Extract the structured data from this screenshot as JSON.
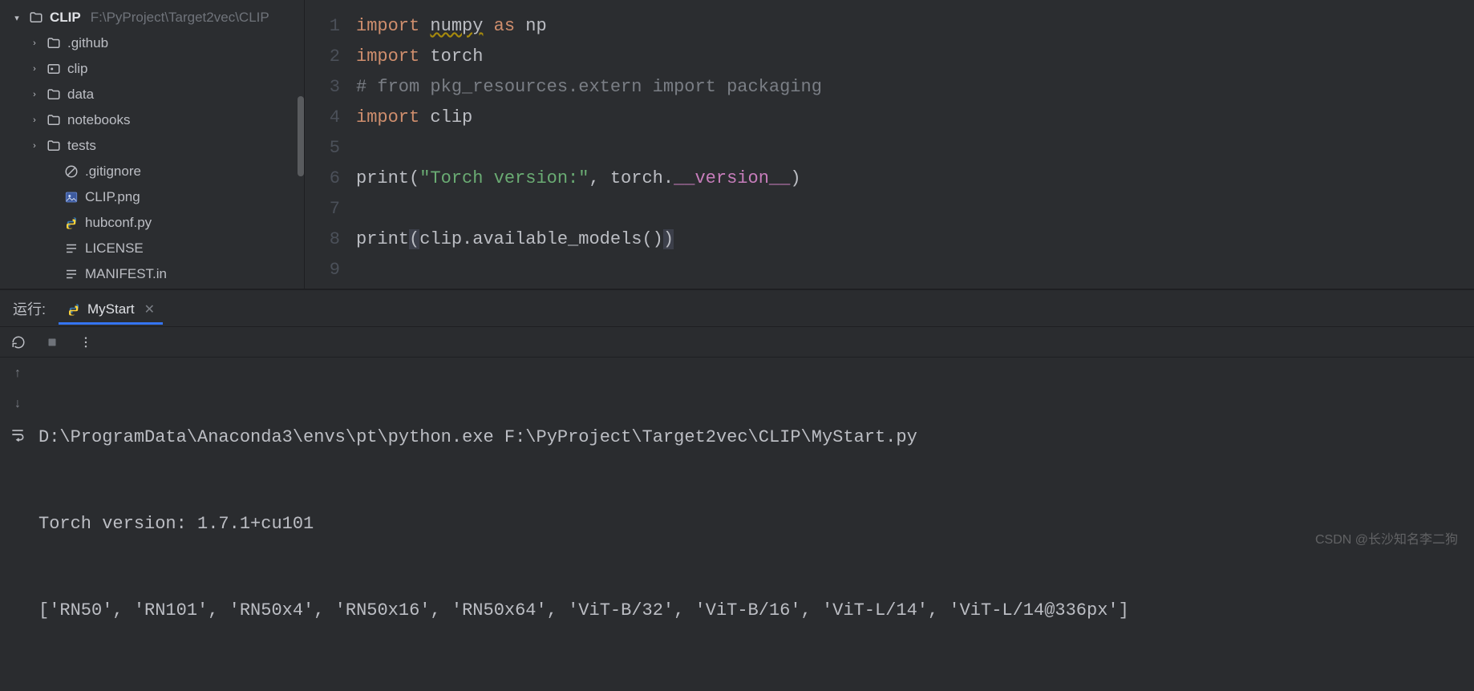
{
  "sidebar": {
    "project_name": "CLIP",
    "project_path": "F:\\PyProject\\Target2vec\\CLIP",
    "items": [
      {
        "label": ".github",
        "icon": "folder",
        "expandable": true
      },
      {
        "label": "clip",
        "icon": "folder-src",
        "expandable": true
      },
      {
        "label": "data",
        "icon": "folder",
        "expandable": true
      },
      {
        "label": "notebooks",
        "icon": "folder",
        "expandable": true
      },
      {
        "label": "tests",
        "icon": "folder",
        "expandable": true
      },
      {
        "label": ".gitignore",
        "icon": "ignore",
        "expandable": false
      },
      {
        "label": "CLIP.png",
        "icon": "image",
        "expandable": false
      },
      {
        "label": "hubconf.py",
        "icon": "python",
        "expandable": false
      },
      {
        "label": "LICENSE",
        "icon": "text",
        "expandable": false
      },
      {
        "label": "MANIFEST.in",
        "icon": "text",
        "expandable": false
      }
    ]
  },
  "editor": {
    "line_numbers": [
      "1",
      "2",
      "3",
      "4",
      "5",
      "6",
      "7",
      "8",
      "9"
    ],
    "tokens": {
      "l1": {
        "kw": "import",
        "mod": "numpy",
        "as": "as",
        "alias": "np"
      },
      "l2": {
        "kw": "import",
        "mod": "torch"
      },
      "l3": "# from pkg_resources.extern import packaging",
      "l4": {
        "kw": "import",
        "mod": "clip"
      },
      "l6": {
        "fn": "print",
        "str": "\"Torch version:\"",
        "comma": ", ",
        "obj": "torch.",
        "dunder": "__version__"
      },
      "l8": {
        "fn": "print",
        "expr": "clip.available_models()"
      }
    }
  },
  "run_panel": {
    "run_label": "运行:",
    "tab_name": "MyStart",
    "output": [
      "D:\\ProgramData\\Anaconda3\\envs\\pt\\python.exe F:\\PyProject\\Target2vec\\CLIP\\MyStart.py",
      "Torch version: 1.7.1+cu101",
      "['RN50', 'RN101', 'RN50x4', 'RN50x16', 'RN50x64', 'ViT-B/32', 'ViT-B/16', 'ViT-L/14', 'ViT-L/14@336px']"
    ]
  },
  "watermark": "CSDN @长沙知名李二狗"
}
